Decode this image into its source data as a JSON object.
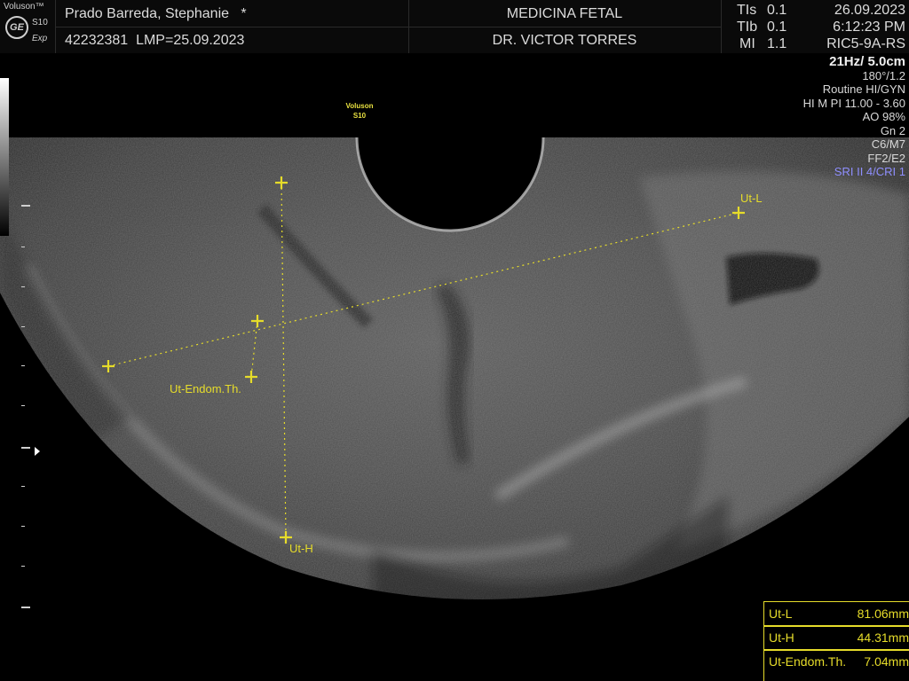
{
  "brand": {
    "name": "Voluson™",
    "model": "S10",
    "sub": "Exp",
    "logo": "GE"
  },
  "patient": {
    "name": "Prado Barreda, Stephanie",
    "marker": "*",
    "id": "42232381",
    "lmp": "LMP=25.09.2023"
  },
  "institution": {
    "name": "MEDICINA FETAL",
    "doctor": "DR. VICTOR TORRES"
  },
  "indices": {
    "tis_label": "TIs",
    "tis_value": "0.1",
    "tib_label": "TIb",
    "tib_value": "0.1",
    "mi_label": "MI",
    "mi_value": "1.1"
  },
  "datetime": {
    "date": "26.09.2023",
    "time": "6:12:23 PM",
    "probe": "RIC5-9A-RS"
  },
  "params": [
    "21Hz/ 5.0cm",
    "180°/1.2",
    "Routine HI/GYN",
    "HI M PI 11.00 - 3.60",
    "AO 98%",
    "Gn  2",
    "C6/M7",
    "FF2/E2",
    "SRI II 4/CRI 1"
  ],
  "image_tag": {
    "line1": "Voluson",
    "line2": "S10"
  },
  "measurement_labels": {
    "length": "Ut-L",
    "height": "Ut-H",
    "endom": "Ut-Endom.Th."
  },
  "results": [
    {
      "label": "Ut-L",
      "value": "81.06mm"
    },
    {
      "label": "Ut-H",
      "value": "44.31mm"
    },
    {
      "label": "Ut-Endom.Th.",
      "value": "7.04mm"
    }
  ],
  "colors": {
    "measurement": "#e6dc2a",
    "sri": "#8f8fff"
  },
  "icons": {
    "focus": "focus-marker-icon",
    "logo": "ge-logo-icon"
  }
}
